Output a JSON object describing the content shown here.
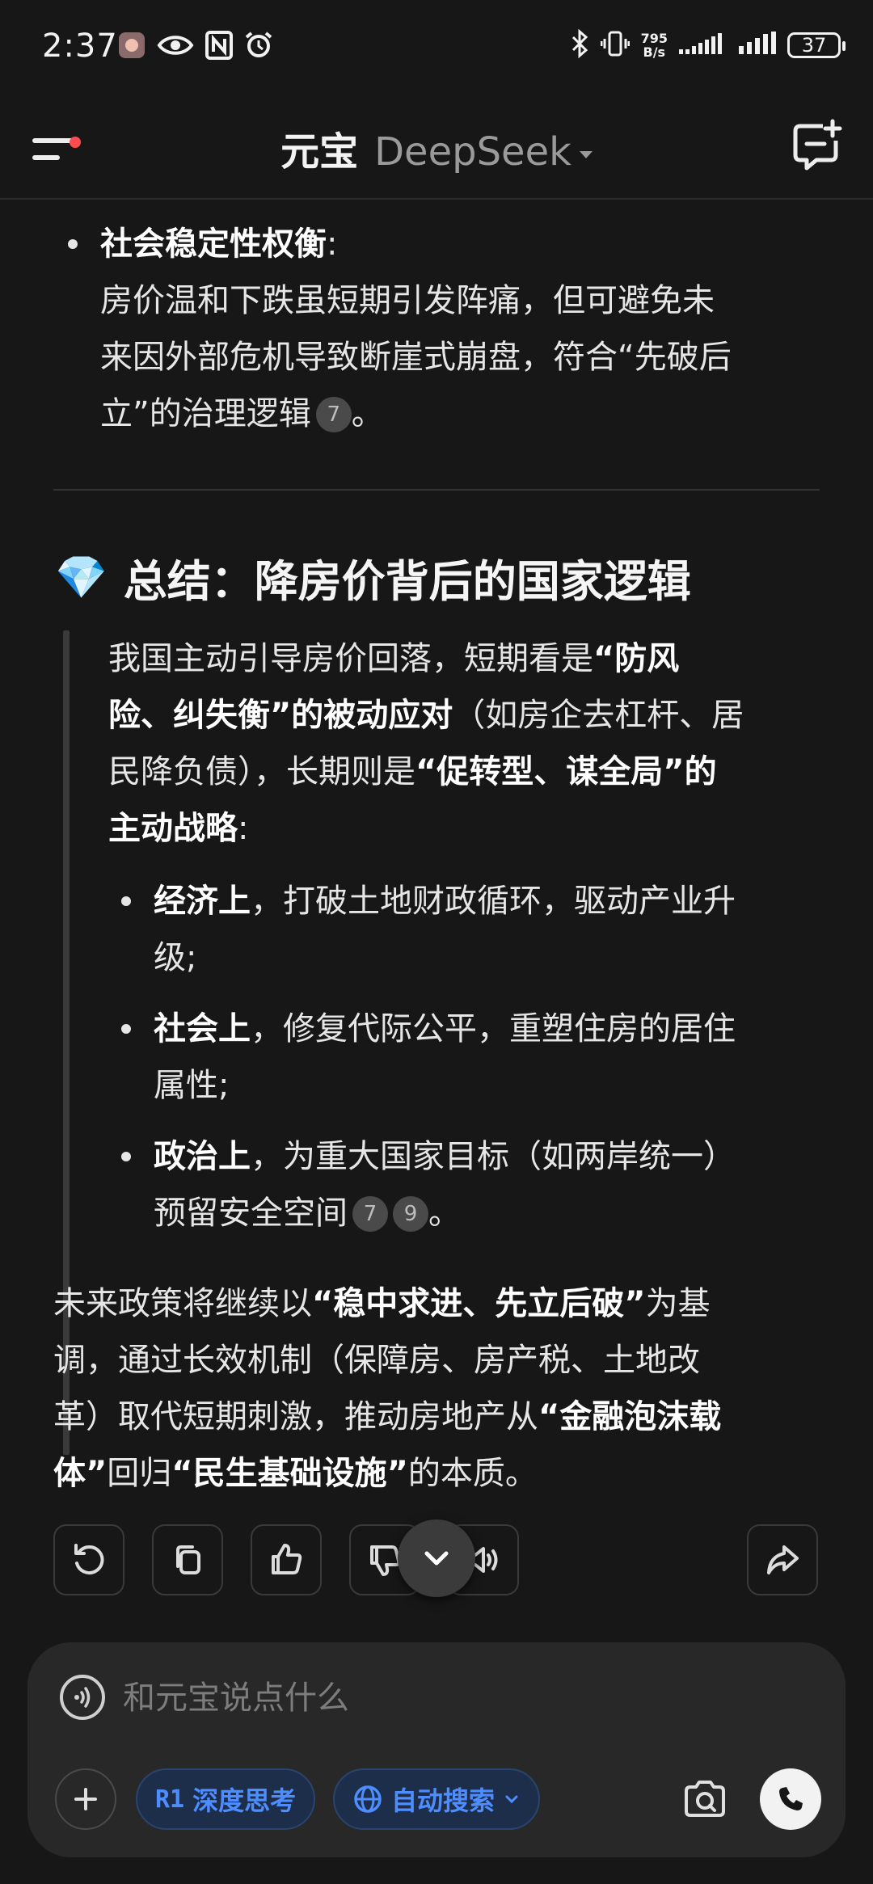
{
  "status_bar": {
    "time": "2:37",
    "net_speed_value": "795",
    "net_speed_unit": "B/s",
    "battery": "37"
  },
  "header": {
    "app_name": "元宝",
    "model_name": "DeepSeek"
  },
  "section_prev": {
    "bullet_title": "社会稳定性权衡",
    "bullet_colon": ":",
    "lines": [
      "房价温和下跌虽短期引发阵痛，但可避免未",
      "来因外部危机导致断崖式崩盘，符合“先破后"
    ],
    "last_line_text": "立”的治理逻辑",
    "ref": "7",
    "last_line_end": "。"
  },
  "summary": {
    "title_emoji": "💎",
    "title": "总结：降房价背后的国家逻辑",
    "quote": {
      "l1_text": "我国主动引导房价回落，短期看是",
      "l1_bold": "“防风",
      "l2_bold": "险、纠失衡”的被动应对",
      "l2_text": "（如房企去杠杆、居",
      "l3_text_a": "民降负债），长期则是",
      "l3_bold": "“促转型、谋全局”的",
      "l4_bold": "主动战略",
      "l4_text": ":"
    },
    "bullets": [
      {
        "bold": "经济上",
        "text_l1": "，打破土地财政循环，驱动产业升",
        "text_l2": "级;"
      },
      {
        "bold": "社会上",
        "text_l1": "，修复代际公平，重塑住房的居住",
        "text_l2": "属性;"
      },
      {
        "bold": "政治上",
        "text_l1": "，为重大国家目标（如两岸统一）",
        "text_l2": "预留安全空间",
        "refs": [
          "7",
          "9"
        ],
        "end": "。"
      }
    ]
  },
  "conclusion": {
    "l1_text": "未来政策将继续以",
    "l1_bold": "“稳中求进、先立后破”",
    "l1_end": "为基",
    "l2_text": "调，通过长效机制（保障房、房产税、土地改",
    "l3_text": "革）取代短期刺激，推动房地产从",
    "l3_bold": "“金融泡沫载",
    "l4_bold": "体”",
    "l4_text": "回归",
    "l4_bold2": "“民生基础设施”",
    "l4_end": "的本质。"
  },
  "input": {
    "placeholder": "和元宝说点什么",
    "chip_deep_think": "深度思考",
    "chip_deep_think_badge": "R1",
    "chip_auto_search": "自动搜索"
  },
  "colors": {
    "background": "#171717",
    "accent_blue": "#4d8dff",
    "notification_dot": "#ff4d4f"
  }
}
